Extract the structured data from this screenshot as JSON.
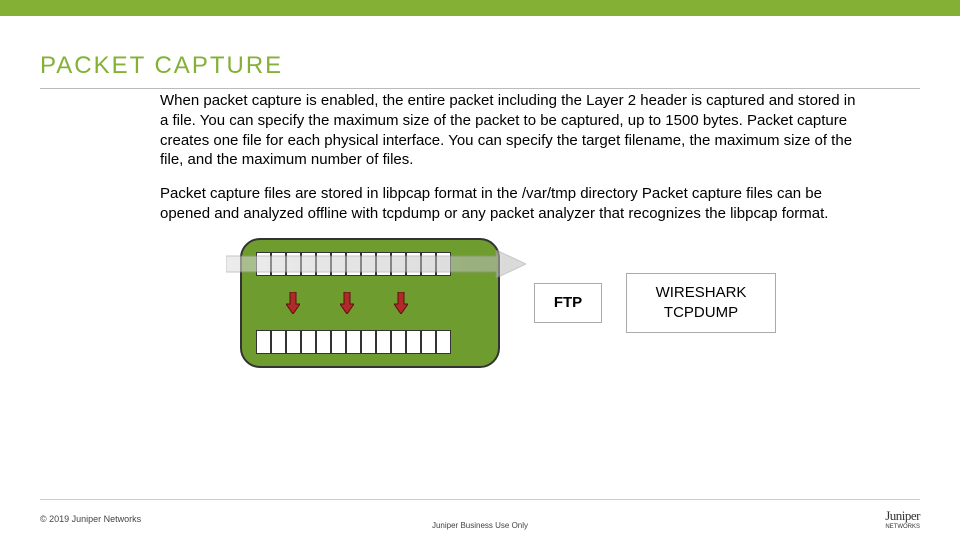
{
  "header": {
    "title": "PACKET CAPTURE"
  },
  "body": {
    "p1": "When packet capture is enabled, the entire packet including the Layer 2 header is captured and stored in a file. You can specify the maximum size of the packet to be captured, up to 1500 bytes. Packet capture creates one file for each physical interface. You can specify the target filename, the maximum size of the file, and the maximum number of files.",
    "p2": "Packet capture files are stored in libpcap format in the /var/tmp directory Packet capture files can be opened and analyzed offline with tcpdump or any packet analyzer that recognizes the libpcap format."
  },
  "diagram": {
    "ftp_label": "FTP",
    "analyzer_line1": "WIRESHARK",
    "analyzer_line2": "TCPDUMP"
  },
  "footer": {
    "copyright": "© 2019 Juniper Networks",
    "confidential": "Juniper Business Use Only",
    "logo_main": "Juniper",
    "logo_sub": "NETWORKS"
  }
}
